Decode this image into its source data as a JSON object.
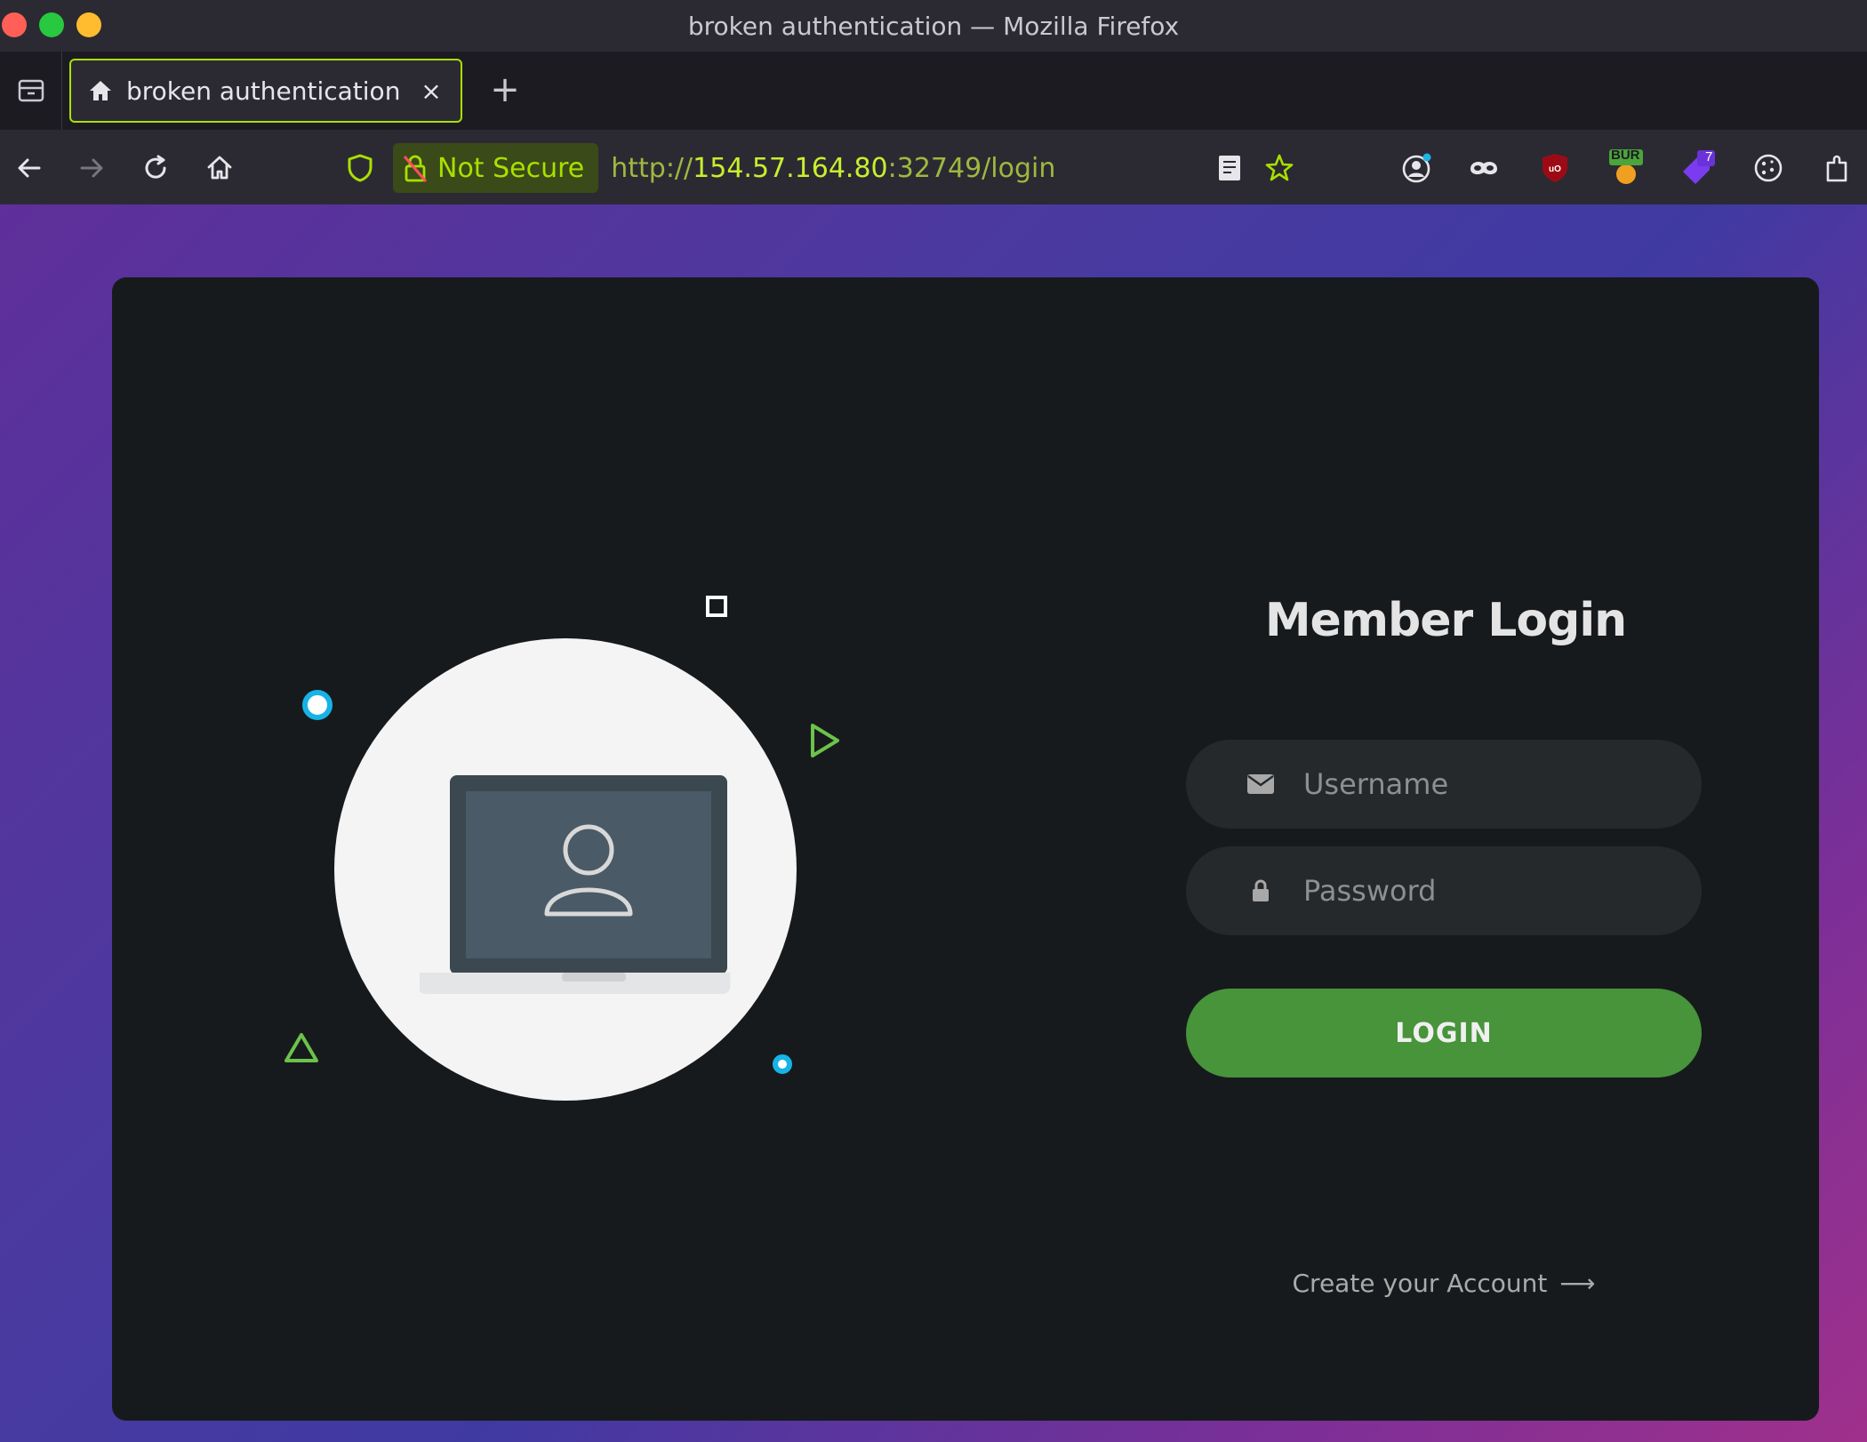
{
  "window": {
    "title": "broken authentication — Mozilla Firefox"
  },
  "tab": {
    "title": "broken authentication",
    "close": "×"
  },
  "newtab": "+",
  "urlbar": {
    "security_label": "Not Secure",
    "url_scheme": "http://",
    "url_host": "154.57.164.80",
    "url_rest": ":32749/login"
  },
  "toolbar_badges": {
    "burp": "BUR",
    "count": "7"
  },
  "login": {
    "title": "Member Login",
    "username_placeholder": "Username",
    "password_placeholder": "Password",
    "login_button": "LOGIN",
    "create_account": "Create your Account",
    "create_arrow": "⟶"
  },
  "colors": {
    "accent_green": "#47943b",
    "tab_border": "#a8e000",
    "card_bg": "#171a1c",
    "deco_cyan": "#17b3e6",
    "deco_green": "#6cc24a"
  }
}
